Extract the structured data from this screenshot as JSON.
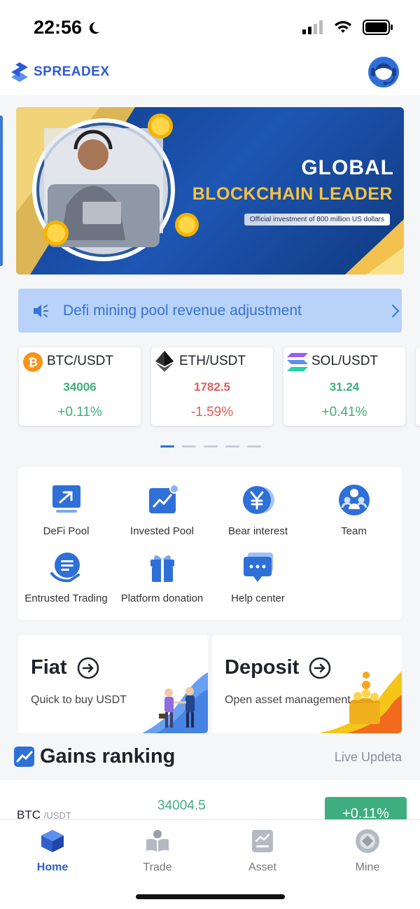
{
  "status_bar": {
    "time": "22:56"
  },
  "header": {
    "logo_text": "SPREADEX"
  },
  "banner": {
    "title_line1": "GLOBAL",
    "title_line2": "BLOCKCHAIN LEADER",
    "subtitle": "Official investment of 800 million US dollars"
  },
  "notice": {
    "text": "Defi mining pool revenue adjustment"
  },
  "tickers": [
    {
      "pair": "BTC/USDT",
      "price": "34006",
      "change": "+0.11%",
      "direction": "up",
      "icon": "bitcoin-icon"
    },
    {
      "pair": "ETH/USDT",
      "price": "1782.5",
      "change": "-1.59%",
      "direction": "down",
      "icon": "ethereum-icon"
    },
    {
      "pair": "SOL/USDT",
      "price": "31.24",
      "change": "+0.41%",
      "direction": "up",
      "icon": "solana-icon"
    }
  ],
  "carousel": {
    "pages": 5,
    "active": 0
  },
  "menu": {
    "items": [
      {
        "label": "DeFi Pool",
        "icon": "defi-pool-icon"
      },
      {
        "label": "Invested Pool",
        "icon": "invested-pool-icon"
      },
      {
        "label": "Bear interest",
        "icon": "yen-coin-icon"
      },
      {
        "label": "Team",
        "icon": "team-icon"
      },
      {
        "label": "Entrusted Trading",
        "icon": "entrusted-trading-icon"
      },
      {
        "label": "Platform donation",
        "icon": "gift-icon"
      },
      {
        "label": "Help center",
        "icon": "chat-bubble-icon"
      }
    ]
  },
  "cards": {
    "fiat": {
      "title": "Fiat",
      "subtitle": "Quick to buy USDT"
    },
    "deposit": {
      "title": "Deposit",
      "subtitle": "Open asset management"
    }
  },
  "gains": {
    "title": "Gains ranking",
    "live_label": "Live Updeta",
    "rows": [
      {
        "symbol": "BTC",
        "quote": "/USDT",
        "price": "34004.5",
        "change": "+0.11%"
      }
    ]
  },
  "tabbar": {
    "tabs": [
      {
        "label": "Home",
        "icon": "cube-icon",
        "active": true
      },
      {
        "label": "Trade",
        "icon": "reading-person-icon",
        "active": false
      },
      {
        "label": "Asset",
        "icon": "chart-document-icon",
        "active": false
      },
      {
        "label": "Mine",
        "icon": "profile-circle-icon",
        "active": false
      }
    ]
  },
  "colors": {
    "accent": "#2f6fd8",
    "up": "#3fae7f",
    "down": "#e45b5b",
    "notice_bg": "#b9d2f7"
  }
}
